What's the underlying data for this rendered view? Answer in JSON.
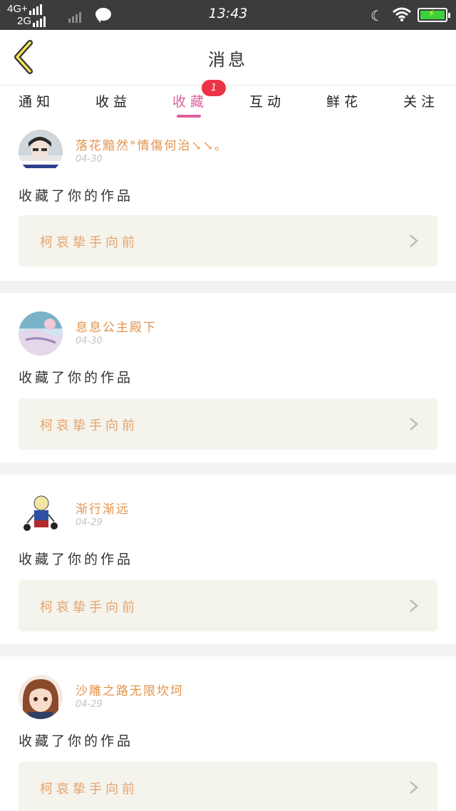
{
  "status_bar": {
    "network_top": "4G+",
    "network_bottom": "2G",
    "time": "13:43"
  },
  "header": {
    "title": "消息",
    "back_icon": "chevron-left-icon"
  },
  "tabs": [
    {
      "label": "通知"
    },
    {
      "label": "收益"
    },
    {
      "label": "收藏",
      "active": true,
      "badge": "1"
    },
    {
      "label": "互动"
    },
    {
      "label": "鲜花"
    },
    {
      "label": "关注"
    }
  ],
  "messages": [
    {
      "user": "落花黯然°情傷何治↘↘。",
      "date": "04-30",
      "action": "收藏了你的作品",
      "work_title": "柯哀挚手向前"
    },
    {
      "user": "息息公主殿下",
      "date": "04-30",
      "action": "收藏了你的作品",
      "work_title": "柯哀挚手向前"
    },
    {
      "user": "渐行渐远",
      "date": "04-29",
      "action": "收藏了你的作品",
      "work_title": "柯哀挚手向前"
    },
    {
      "user": "沙雕之路无限坎坷",
      "date": "04-29",
      "action": "收藏了你的作品",
      "work_title": "柯哀挚手向前"
    }
  ],
  "colors": {
    "accent_pink": "#e0609b",
    "badge_red": "#ea3344",
    "username_orange": "#e3934c",
    "work_card_bg": "#f4f3ec"
  }
}
